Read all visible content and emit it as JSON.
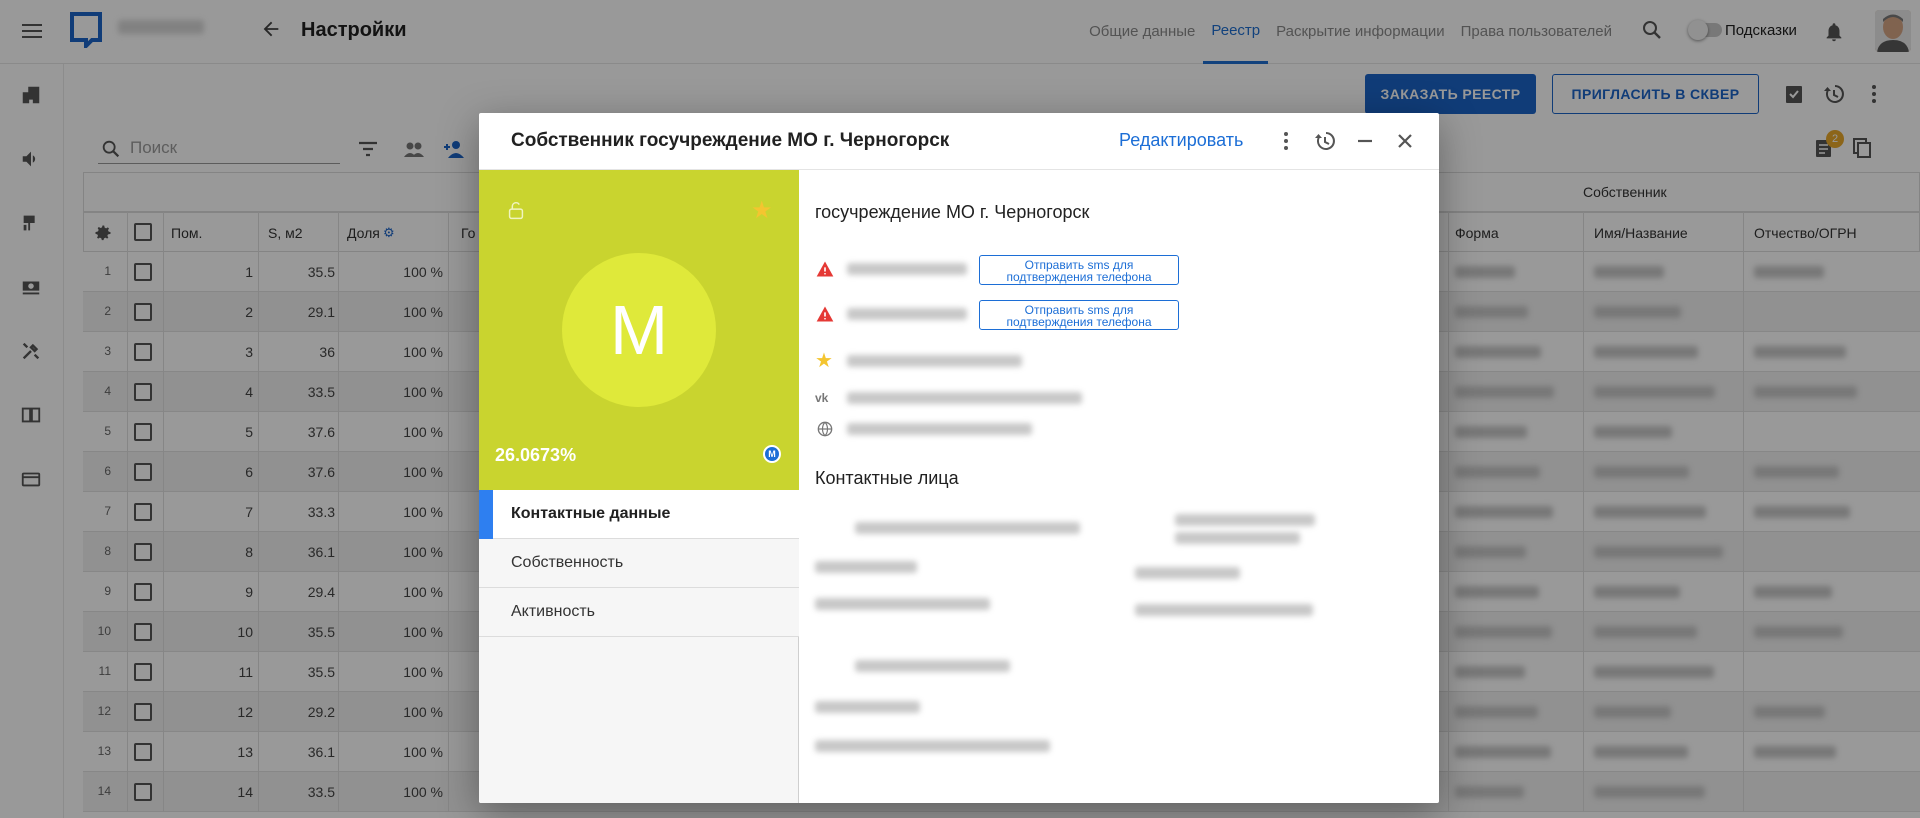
{
  "topbar": {
    "title": "Настройки",
    "tabs": [
      "Общие данные",
      "Реестр",
      "Раскрытие информации",
      "Права пользователей"
    ],
    "active_tab": 1,
    "hints_label": "Подсказки"
  },
  "toolbar": {
    "order_label": "ЗАКАЗАТЬ РЕЕСТР",
    "invite_label": "ПРИГЛАСИТЬ В СКВЕР",
    "search_placeholder": "Поиск",
    "badge_count": "2"
  },
  "table": {
    "group_header": "Собственник",
    "columns": [
      "Пом.",
      "S, м2",
      "Доля",
      "Го",
      "Форма",
      "Имя/Название",
      "Отчество/ОГРН"
    ],
    "rows": [
      {
        "n": "1",
        "pom": "1",
        "s": "35.5",
        "share": "100 %"
      },
      {
        "n": "2",
        "pom": "2",
        "s": "29.1",
        "share": "100 %"
      },
      {
        "n": "3",
        "pom": "3",
        "s": "36",
        "share": "100 %"
      },
      {
        "n": "4",
        "pom": "4",
        "s": "33.5",
        "share": "100 %"
      },
      {
        "n": "5",
        "pom": "5",
        "s": "37.6",
        "share": "100 %"
      },
      {
        "n": "6",
        "pom": "6",
        "s": "37.6",
        "share": "100 %"
      },
      {
        "n": "7",
        "pom": "7",
        "s": "33.3",
        "share": "100 %"
      },
      {
        "n": "8",
        "pom": "8",
        "s": "36.1",
        "share": "100 %"
      },
      {
        "n": "9",
        "pom": "9",
        "s": "29.4",
        "share": "100 %"
      },
      {
        "n": "10",
        "pom": "10",
        "s": "35.5",
        "share": "100 %"
      },
      {
        "n": "11",
        "pom": "11",
        "s": "35.5",
        "share": "100 %"
      },
      {
        "n": "12",
        "pom": "12",
        "s": "29.2",
        "share": "100 %"
      },
      {
        "n": "13",
        "pom": "13",
        "s": "36.1",
        "share": "100 %"
      },
      {
        "n": "14",
        "pom": "14",
        "s": "33.5",
        "share": "100 %"
      }
    ]
  },
  "modal": {
    "title": "Собственник госучреждение МО г. Черногорск",
    "edit_label": "Редактировать",
    "avatar_letter": "М",
    "share": "26.0673%",
    "badge_letter": "М",
    "menu": [
      "Контактные данные",
      "Собственность",
      "Активность"
    ],
    "active_menu": 0,
    "owner_name": "госучреждение МО г. Черногорск",
    "sms_label": "Отправить sms для подтверждения телефона",
    "contacts_heading": "Контактные лица"
  },
  "colors": {
    "accent": "#1c64c8",
    "card": "#c9d42f",
    "avatar": "#dfe93a",
    "warning": "#e53935",
    "star": "#f4c530"
  }
}
